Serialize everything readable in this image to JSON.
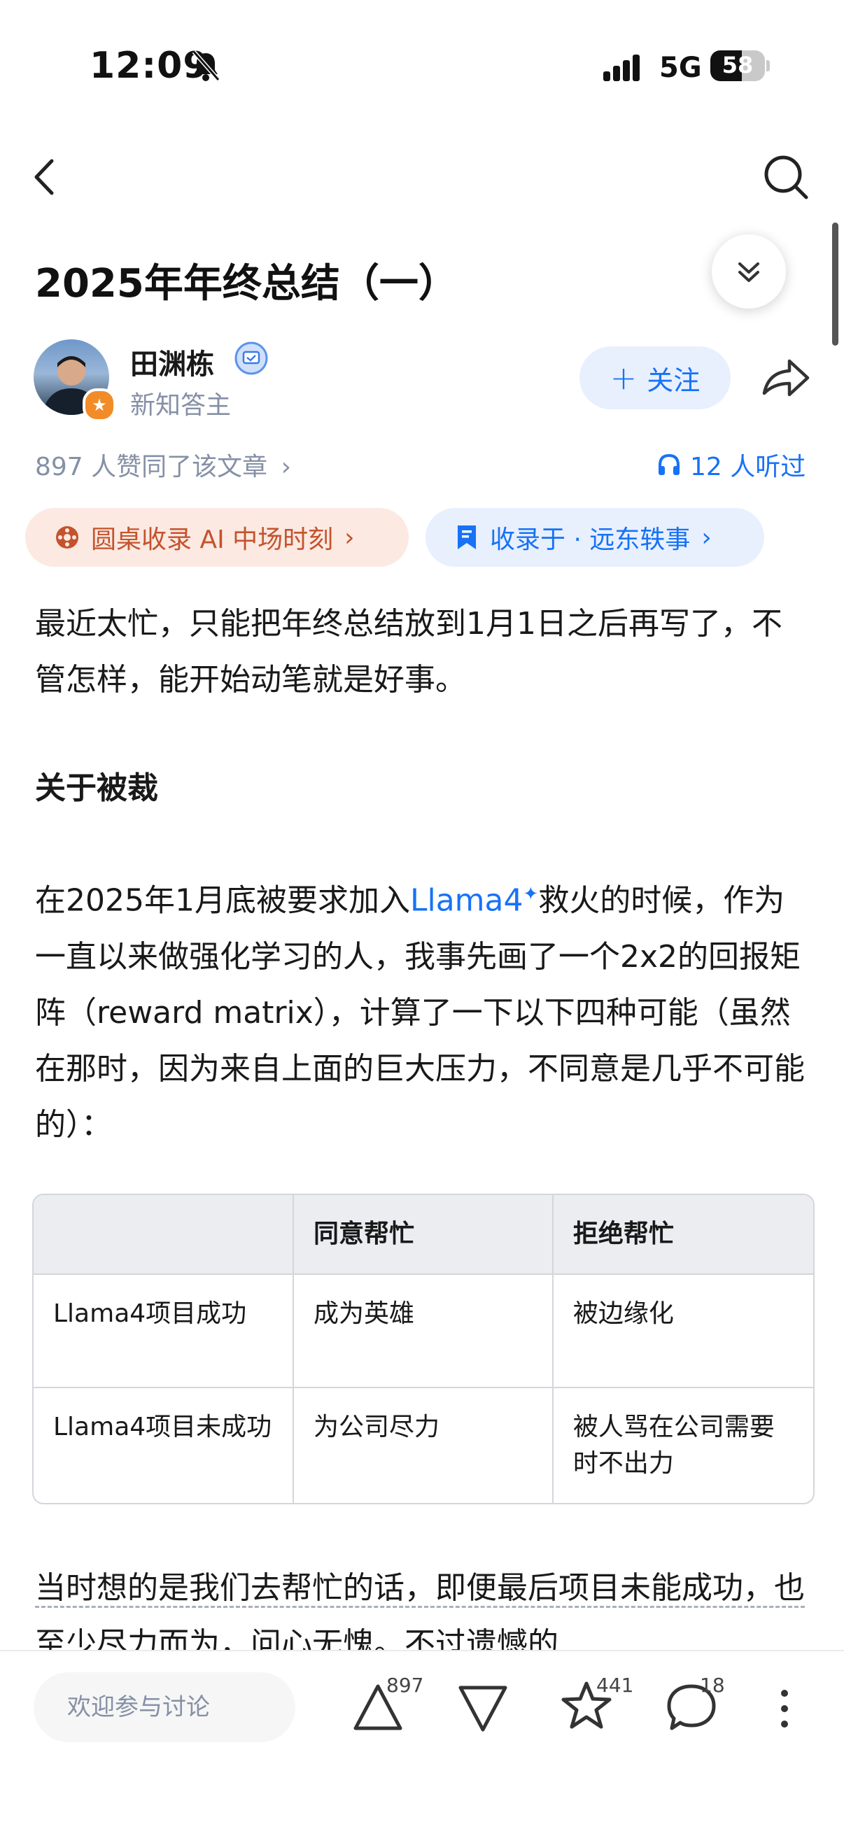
{
  "status_bar": {
    "time": "12:09",
    "network": "5G",
    "battery_level": "58",
    "battery_fraction": 0.58
  },
  "nav": {
    "back_icon": "chevron-left-icon",
    "search_icon": "search-icon"
  },
  "article": {
    "title": "2025年年终总结（一）",
    "author": {
      "name": "田渊栋",
      "subtitle": "新知答主"
    },
    "follow_label": "关注",
    "likes_text": "897 人赞同了该文章",
    "listens_text": "12 人听过",
    "pill_roundtable": "圆桌收录 AI 中场时刻",
    "pill_collection": "收录于 · 远东轶事",
    "para1": "最近太忙，只能把年终总结放到1月1日之后再写了，不管怎样，能开始动笔就是好事。",
    "heading1": "关于被裁",
    "para2_before": "在2025年1月底被要求加入",
    "para2_link": "Llama4",
    "para2_after": "救火的时候，作为一直以来做强化学习的人，我事先画了一个2x2的回报矩阵（reward matrix），计算了一下以下四种可能（虽然在那时，因为来自上面的巨大压力，不同意是几乎不可能的）：",
    "table": {
      "headers": [
        "",
        "同意帮忙",
        "拒绝帮忙"
      ],
      "rows": [
        [
          "Llama4项目成功",
          "成为英雄",
          "被边缘化"
        ],
        [
          "Llama4项目未成功",
          "为公司尽力",
          "被人骂在公司需要时不出力"
        ]
      ]
    },
    "para3": "当时想的是我们去帮忙的话，即便最后项目未能成功，也至少尽力而为，问心无愧。不过遗憾的"
  },
  "bottom_bar": {
    "comment_placeholder": "欢迎参与讨论",
    "upvote_count": "897",
    "favorite_count": "441",
    "comment_count": "18"
  }
}
